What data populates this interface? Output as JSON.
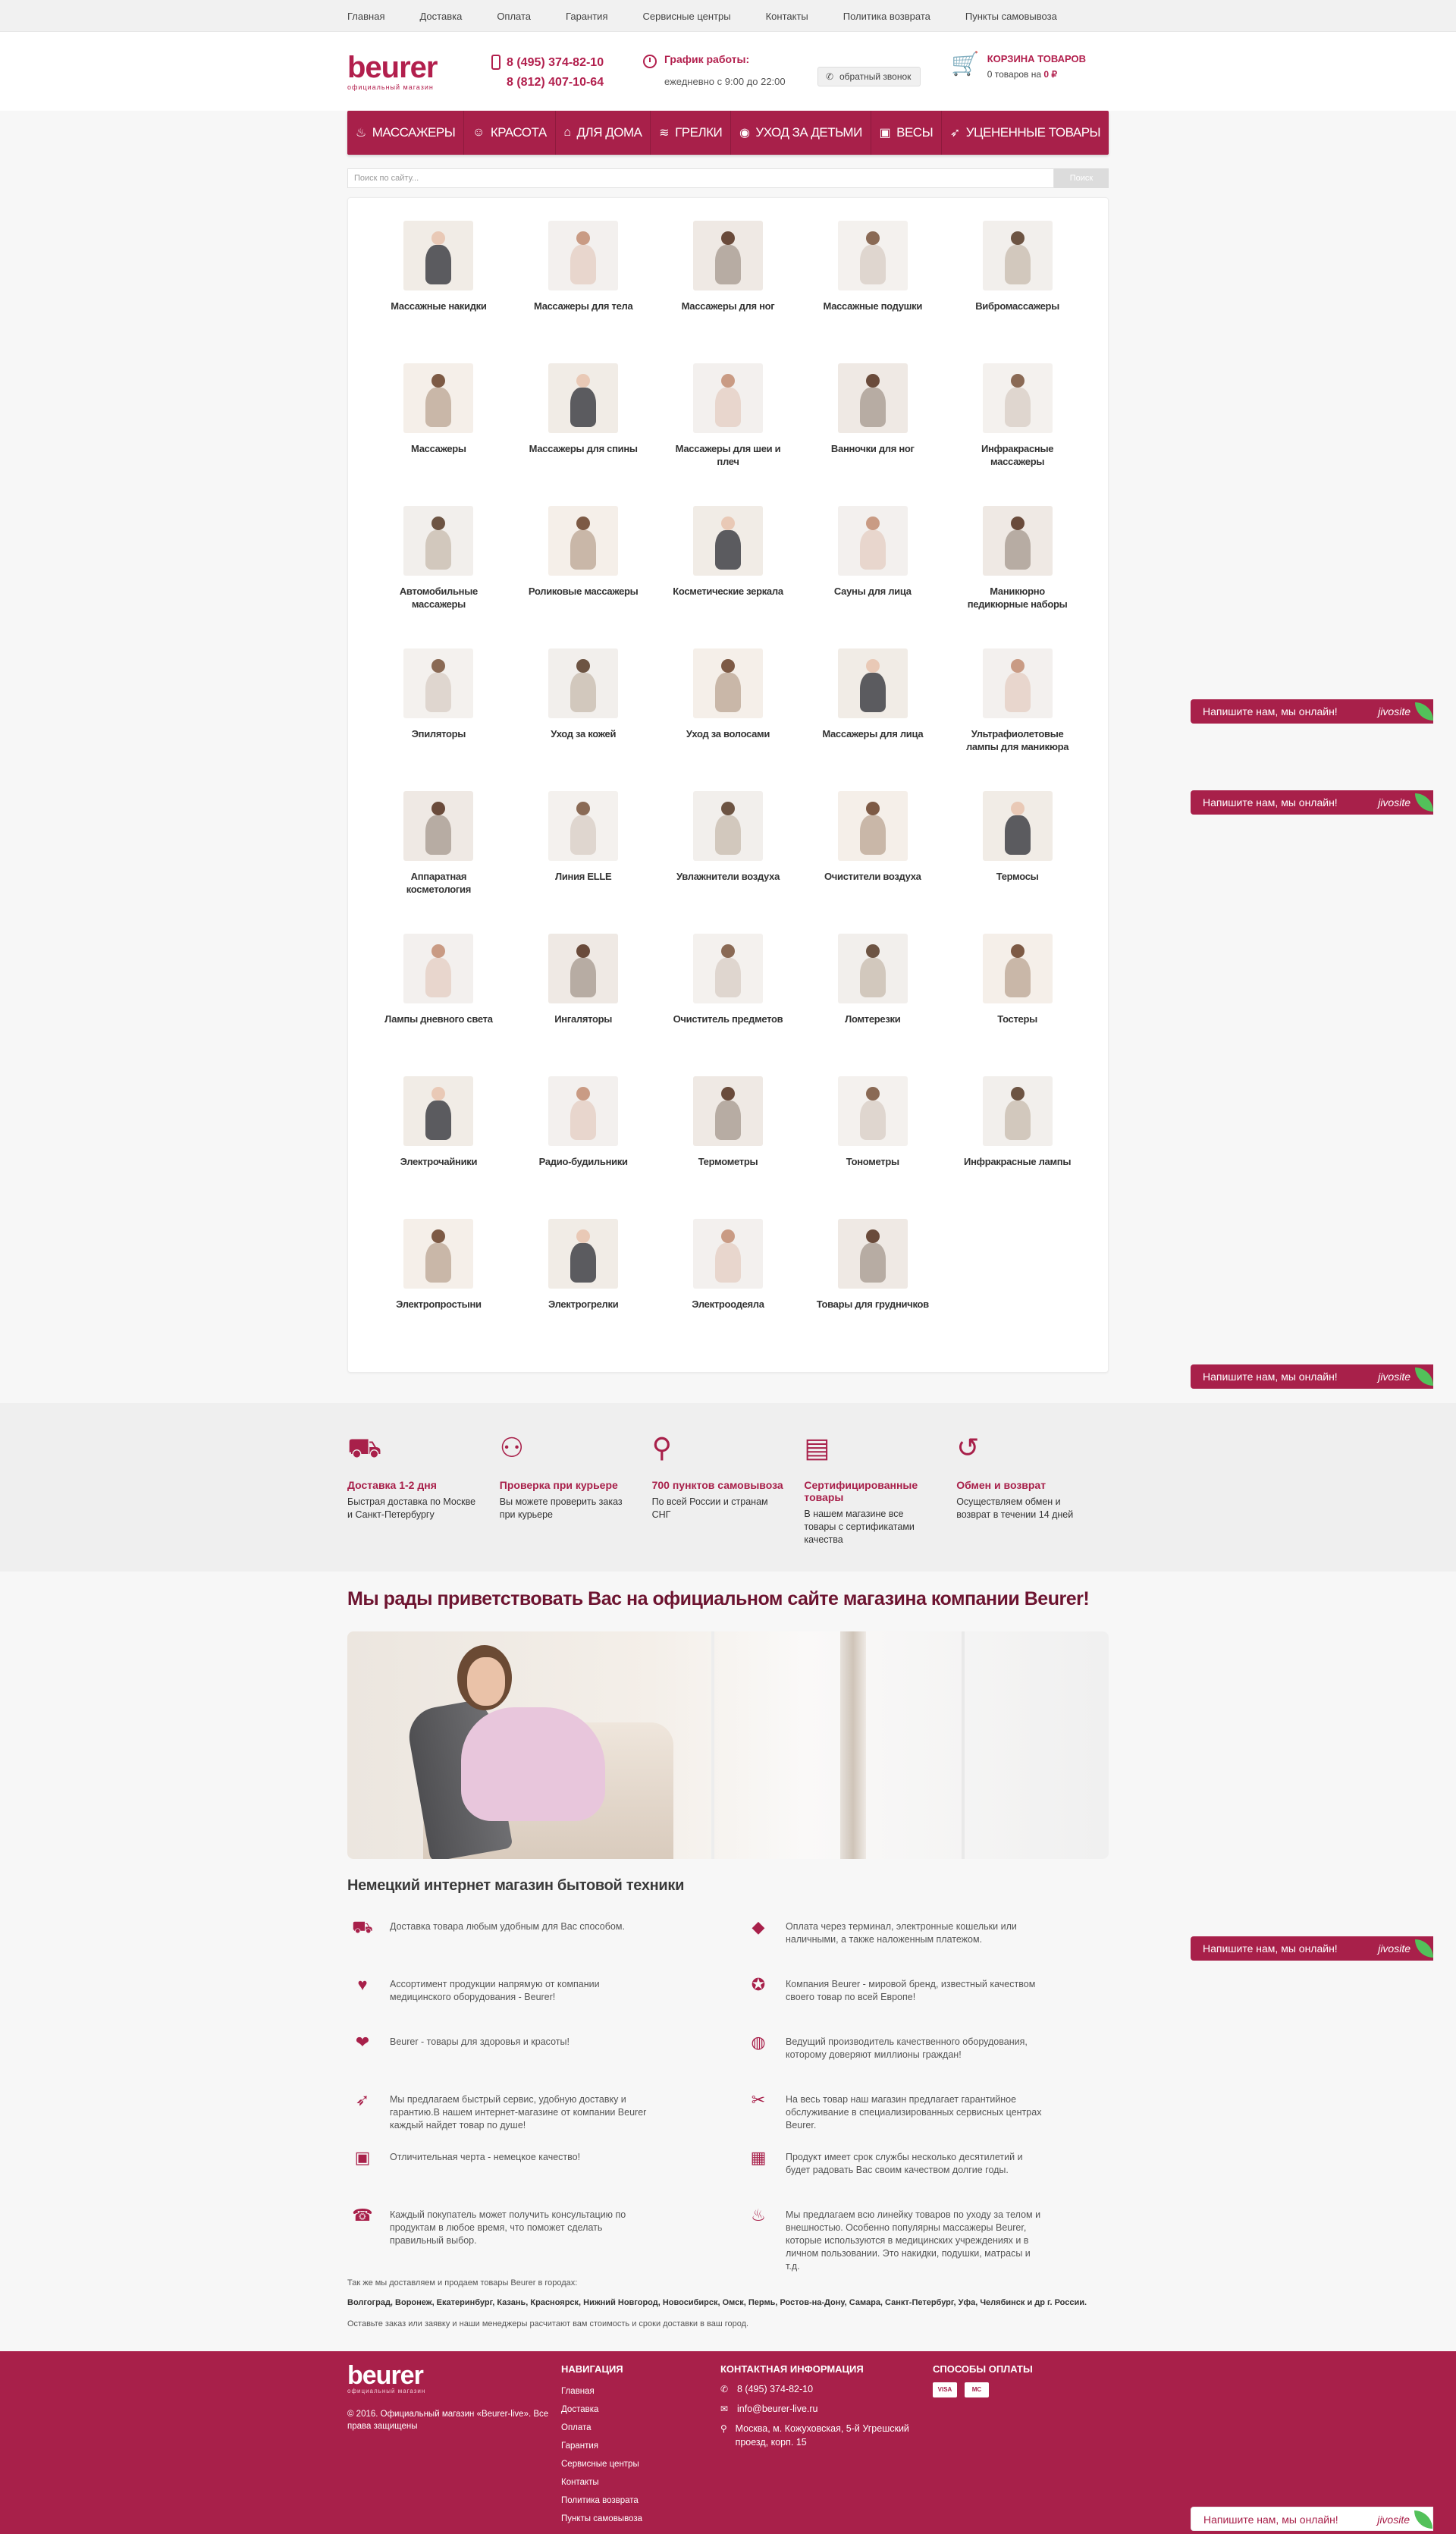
{
  "topnav": [
    "Главная",
    "Доставка",
    "Оплата",
    "Гарантия",
    "Сервисные центры",
    "Контакты",
    "Политика возврата",
    "Пункты самовывоза"
  ],
  "header": {
    "brand": "beurer",
    "tagline": "официальный магазин",
    "phone1": "8 (495) 374-82-10",
    "phone2": "8 (812) 407-10-64",
    "schedule_title": "График работы:",
    "schedule_text": "ежедневно с 9:00 до 22:00",
    "callback": "обратный звонок",
    "cart_title": "КОРЗИНА ТОВАРОВ",
    "cart_status_prefix": "0 товаров на",
    "cart_sum": "0 ₽"
  },
  "menu": [
    {
      "label": "Массажеры",
      "icon": "chair-icon"
    },
    {
      "label": "Красота",
      "icon": "person-icon"
    },
    {
      "label": "Для дома",
      "icon": "home-icon"
    },
    {
      "label": "Грелки",
      "icon": "heat-icon"
    },
    {
      "label": "Уход за детьми",
      "icon": "baby-icon"
    },
    {
      "label": "Весы",
      "icon": "scale-icon"
    },
    {
      "label": "Уцененные товары",
      "icon": "run-icon"
    }
  ],
  "search": {
    "placeholder": "Поиск по сайту...",
    "button": "Поиск"
  },
  "catalog": [
    "Массажные накидки",
    "Массажеры для тела",
    "Массажеры для ног",
    "Массажные подушки",
    "Вибромассажеры",
    "Массажеры",
    "Массажеры для спины",
    "Массажеры для шеи и плеч",
    "Ванночки для ног",
    "Инфракрасные массажеры",
    "Автомобильные массажеры",
    "Роликовые массажеры",
    "Косметические зеркала",
    "Сауны для лица",
    "Маникюрно педикюрные наборы",
    "Эпиляторы",
    "Уход за кожей",
    "Уход за волосами",
    "Массажеры для лица",
    "Ультрафиолетовые лампы для маникюра",
    "Аппаратная косметология",
    "Линия ELLE",
    "Увлажнители воздуха",
    "Очистители воздуха",
    "Термосы",
    "Лампы дневного света",
    "Ингаляторы",
    "Очиститель предметов",
    "Ломтерезки",
    "Тостеры",
    "Электрочайники",
    "Радио-будильники",
    "Термометры",
    "Тонометры",
    "Инфракрасные лампы",
    "Электропростыни",
    "Электрогрелки",
    "Электроодеяла",
    "Товары для грудничков"
  ],
  "features": [
    {
      "title": "Доставка 1-2 дня",
      "text": "Быстрая доставка по Москве и Санкт-Петербургу",
      "icon": "truck-icon"
    },
    {
      "title": "Проверка при курьере",
      "text": "Вы можете проверить заказ при курьере",
      "icon": "courier-icon"
    },
    {
      "title": "700 пунктов самовывоза",
      "text": "По всей России и странам СНГ",
      "icon": "pin-icon"
    },
    {
      "title": "Сертифицированные товары",
      "text": "В нашем магазине все товары с сертификатами качества",
      "icon": "certificate-icon"
    },
    {
      "title": "Обмен и возврат",
      "text": "Осуществляем обмен и возврат в течении 14 дней",
      "icon": "return-icon"
    }
  ],
  "welcome_title": "Мы рады приветствовать Вас на официальном сайте магазина компании Beurer!",
  "info_title": "Немецкий интернет магазин бытовой техники",
  "info": [
    {
      "text": "Доставка товара любым удобным для Вас способом.",
      "icon": "truck-icon"
    },
    {
      "text": "Оплата через терминал, электронные кошельки или наличными, а также наложенным платежом.",
      "icon": "wallet-icon"
    },
    {
      "text": "Ассортимент продукции напрямую от компании медицинского оборудования - Beurer!",
      "icon": "heartbeat-icon"
    },
    {
      "text": "Компания Beurer - мировой бренд, известный качеством своего товар по всей Европе!",
      "icon": "award-icon"
    },
    {
      "text": "Beurer - товары для здоровья и красоты!",
      "icon": "heart-hand-icon"
    },
    {
      "text": "Ведущий производитель качественного оборудования, которому доверяют миллионы граждан!",
      "icon": "globe-icon"
    },
    {
      "text": "Мы предлагаем быстрый сервис, удобную доставку и гарантию.В нашем интернет-магазине от компании Beurer каждый найдет товар по душе!",
      "icon": "runner-icon"
    },
    {
      "text": "На весь товар наш магазин предлагает гарантийное обслуживание в специализированных сервисных центрах Beurer.",
      "icon": "tools-icon"
    },
    {
      "text": "Отличительная черта - немецкое качество!",
      "icon": "quality-icon"
    },
    {
      "text": "Продукт имеет срок службы несколько десятилетий и будет радовать Вас своим качеством долгие годы.",
      "icon": "calendar-icon"
    },
    {
      "text": "Каждый покупатель может получить консультацию по продуктам в любое время, что поможет сделать правильный выбор.",
      "icon": "support-icon"
    },
    {
      "text": "Мы предлагаем всю линейку товаров по уходу за телом и внешностью. Особенно популярны массажеры Beurer, которые используются в медицинских учреждениях и в личном пользовании. Это накидки, подушки, матрасы и т.д.",
      "icon": "massage-icon"
    }
  ],
  "cities_intro": "Так же мы доставляем и продаем товары Beurer в городах:",
  "cities_list": "Волгоград, Воронеж, Екатеринбург, Казань, Красноярск, Нижний Новгород, Новосибирск, Омск, Пермь, Ростов-на-Дону, Самара, Санкт-Петербург, Уфа, Челябинск и др г. России.",
  "cities_note": "Оставьте заказ или заявку и наши менеджеры расчитают вам стоимость и сроки доставки в ваш город.",
  "footer": {
    "brand": "beurer",
    "tagline": "официальный магазин",
    "copyright": "© 2016. Официальный магазин «Beurer-live». Все права защищены",
    "nav_title": "НАВИГАЦИЯ",
    "nav": [
      "Главная",
      "Доставка",
      "Оплата",
      "Гарантия",
      "Сервисные центры",
      "Контакты",
      "Политика возврата",
      "Пункты самовывоза"
    ],
    "contact_title": "КОНТАКТНАЯ ИНФОРМАЦИЯ",
    "phone": "8 (495) 374-82-10",
    "email": "info@beurer-live.ru",
    "address": "Москва, м. Кожуховская, 5-й Угрешский проезд, корп. 15",
    "pay_title": "СПОСОБЫ ОПЛАТЫ",
    "cards": [
      "VISA",
      "MC"
    ]
  },
  "chat": {
    "label": "Напишите нам, мы онлайн!",
    "brand": "jivosite"
  },
  "colors": {
    "brand": "#a8204a",
    "footer": "#a8204a",
    "accent_dark": "#6d1430"
  }
}
